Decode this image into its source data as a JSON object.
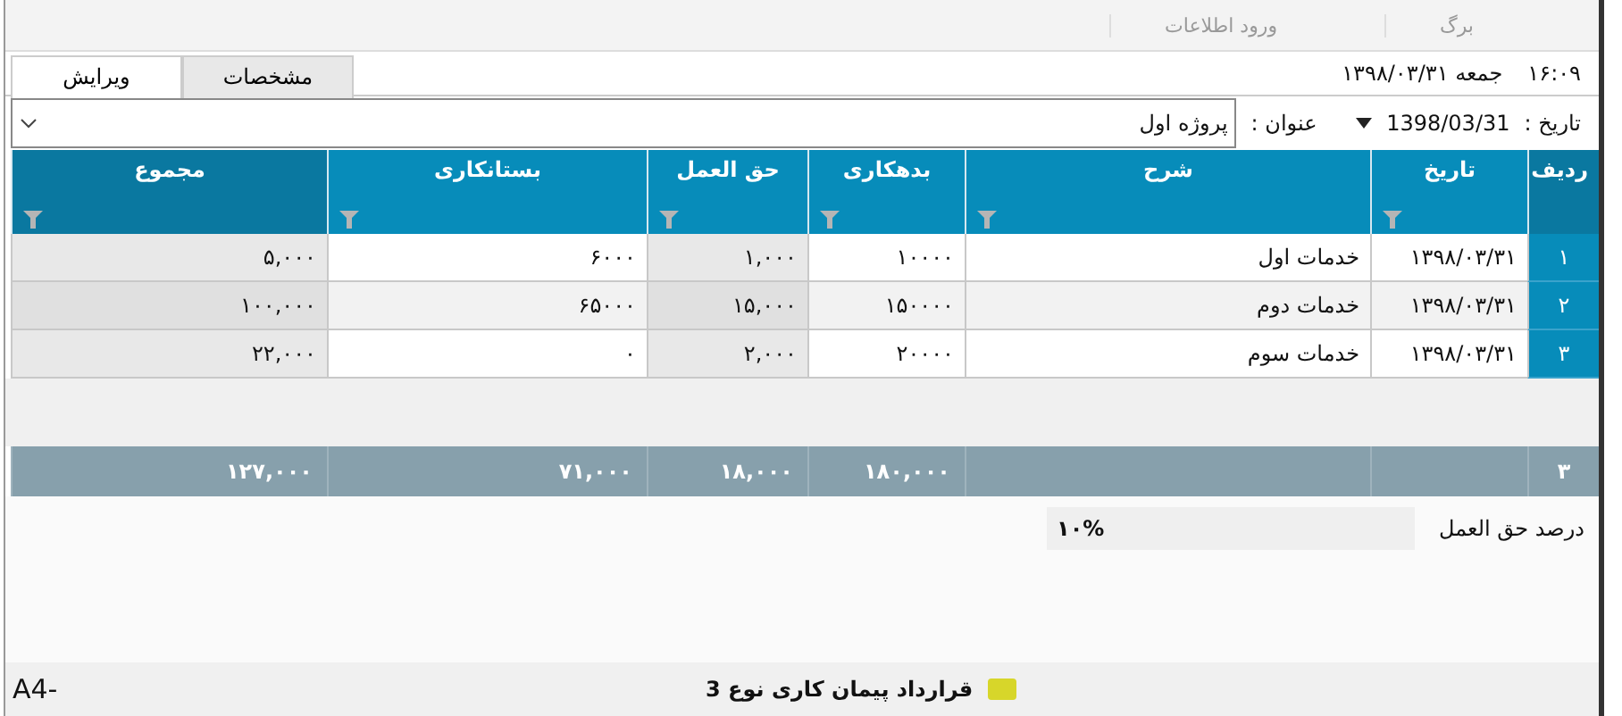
{
  "top_tabs": [
    "برگ",
    "ورود اطلاعات"
  ],
  "status": {
    "time": "۱۶:۰۹",
    "date": "جمعه ۱۳۹۸/۰۳/۳۱"
  },
  "tabs": [
    {
      "label": "مشخصات",
      "selected": false
    },
    {
      "label": "ویرایش",
      "selected": true
    }
  ],
  "filter": {
    "date_label": "تاریخ :",
    "date_value": "1398/03/31",
    "title_label": "عنوان :",
    "title_value": "پروژه اول"
  },
  "table": {
    "columns": [
      {
        "label": "ردیف",
        "filter": false
      },
      {
        "label": "تاریخ",
        "filter": true,
        "readonly": false
      },
      {
        "label": "شرح",
        "filter": true,
        "readonly": false
      },
      {
        "label": "بدهکاری",
        "filter": true,
        "readonly": false
      },
      {
        "label": "حق العمل",
        "filter": true,
        "readonly": true
      },
      {
        "label": "بستانکاری",
        "filter": true,
        "readonly": false
      },
      {
        "label": "مجموع",
        "filter": true,
        "readonly": true
      }
    ],
    "rows": [
      [
        "۱",
        "۱۳۹۸/۰۳/۳۱",
        "خدمات اول",
        "۱۰۰۰۰",
        "۱,۰۰۰",
        "۶۰۰۰",
        "۵,۰۰۰"
      ],
      [
        "۲",
        "۱۳۹۸/۰۳/۳۱",
        "خدمات دوم",
        "۱۵۰۰۰۰",
        "۱۵,۰۰۰",
        "۶۵۰۰۰",
        "۱۰۰,۰۰۰"
      ],
      [
        "۳",
        "۱۳۹۸/۰۳/۳۱",
        "خدمات سوم",
        "۲۰۰۰۰",
        "۲,۰۰۰",
        "۰",
        "۲۲,۰۰۰"
      ]
    ],
    "totals": {
      "count": "۳",
      "debit": "۱۸۰,۰۰۰",
      "fee": "۱۸,۰۰۰",
      "credit": "۷۱,۰۰۰",
      "sum": "۱۲۷,۰۰۰"
    }
  },
  "percent": {
    "label": "درصد حق العمل",
    "value": "۱۰%"
  },
  "bottom": {
    "page_size": "A4-",
    "title": "قرارداد پیمان کاری نوع 3"
  }
}
